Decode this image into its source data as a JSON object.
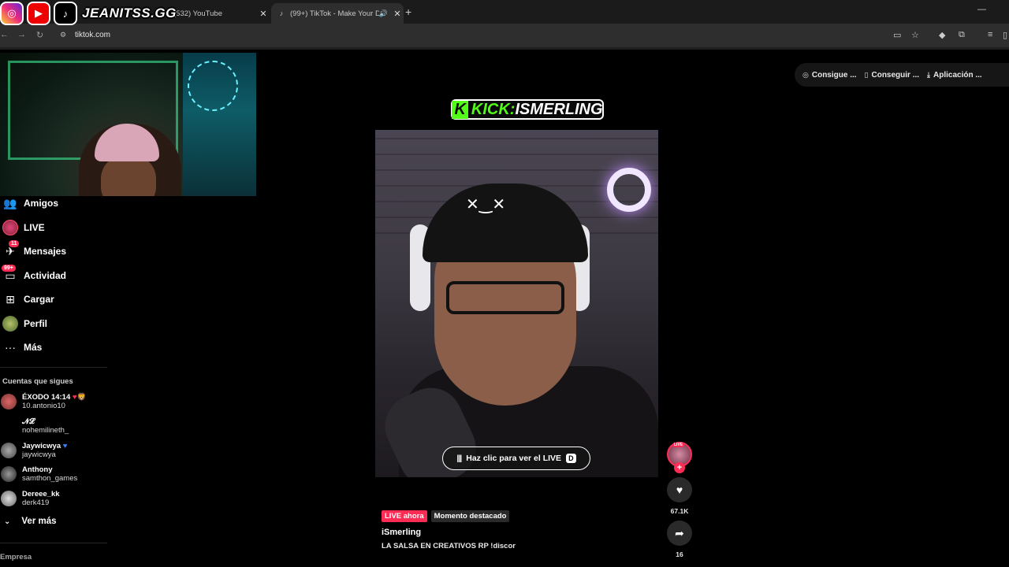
{
  "browser": {
    "tabs": [
      {
        "title": "(532) YouTube",
        "favicon": "youtube-icon"
      },
      {
        "title": "(99+) TikTok - Make Your D…",
        "favicon": "tiktok-icon"
      }
    ],
    "url": "tiktok.com"
  },
  "overlay": {
    "brand": "JEANITSS.GG",
    "kick_label": "KICK:",
    "kick_name": "ISMERLING",
    "kick_logo": "K"
  },
  "top_actions": [
    {
      "label": "Consigue ...",
      "icon": "coin-icon"
    },
    {
      "label": "Conseguir ...",
      "icon": "phone-icon"
    },
    {
      "label": "Aplicación ...",
      "icon": "download-icon"
    }
  ],
  "sidebar": {
    "items": [
      {
        "label": "Amigos",
        "icon": "friends-icon"
      },
      {
        "label": "LIVE",
        "icon": "live-icon"
      },
      {
        "label": "Mensajes",
        "icon": "messages-icon",
        "badge": "11"
      },
      {
        "label": "Actividad",
        "icon": "activity-icon",
        "badge": "99+"
      },
      {
        "label": "Cargar",
        "icon": "upload-icon"
      },
      {
        "label": "Perfil",
        "icon": "profile-icon"
      },
      {
        "label": "Más",
        "icon": "more-icon"
      }
    ],
    "following_title": "Cuentas que sigues",
    "following": [
      {
        "name": "ÉXODO 14:14",
        "handle": "10.antonio10"
      },
      {
        "name": "𝓝𝓛",
        "handle": "nohemilineth_"
      },
      {
        "name": "Jaywicwya",
        "handle": "jaywicwya"
      },
      {
        "name": "Anthony",
        "handle": "samthon_games"
      },
      {
        "name": "Dereee_kk",
        "handle": "derk419"
      }
    ],
    "see_more": "Ver más",
    "footer": "Empresa"
  },
  "video": {
    "watch_live": "Haz clic para ver el LIVE",
    "watch_key": "D",
    "tag_live": "LIVE ahora",
    "tag_highlight": "Momento destacado",
    "author": "iSmerling",
    "description": "LA SALSA EN CREATIVOS RP !discor",
    "live_badge": "LIVE",
    "likes": "67.1K",
    "shares": "16"
  },
  "colors": {
    "accent": "#fe2c55",
    "kick_green": "#53fc18",
    "background": "#000000"
  }
}
